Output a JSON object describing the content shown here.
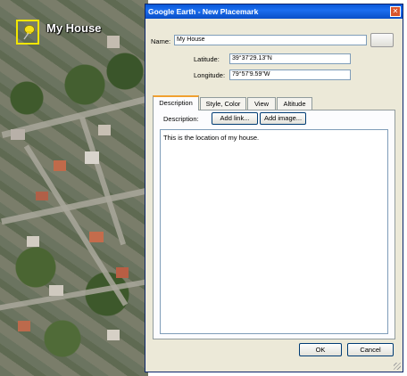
{
  "map": {
    "placemark_label": "My House",
    "placemark_icon": "pushpin-icon",
    "highlight_color": "#f2e600"
  },
  "dialog": {
    "title": "Google Earth - New Placemark",
    "close_icon": "close-icon",
    "name_label": "Name:",
    "name_value": "My House",
    "latitude_label": "Latitude:",
    "latitude_value": "39°37'29.13\"N",
    "longitude_label": "Longitude:",
    "longitude_value": "79°57'9.59\"W",
    "tabs": [
      {
        "label": "Description",
        "active": true
      },
      {
        "label": "Style, Color",
        "active": false
      },
      {
        "label": "View",
        "active": false
      },
      {
        "label": "Altitude",
        "active": false
      }
    ],
    "description_label": "Description:",
    "add_link_label": "Add link...",
    "add_image_label": "Add image...",
    "description_text": "This is the location of my house.",
    "ok_label": "OK",
    "cancel_label": "Cancel"
  },
  "colors": {
    "titlebar": "#0a58d8",
    "dialog_bg": "#ece9d8",
    "active_tab_accent": "#f0a030"
  }
}
